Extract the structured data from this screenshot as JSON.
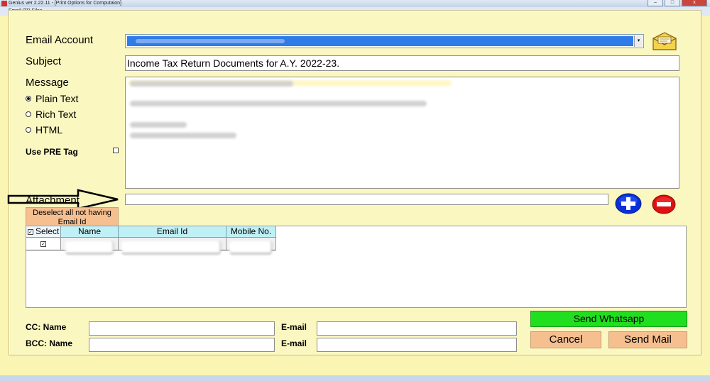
{
  "window": {
    "title": "Genius ver 2.22.11 - [Print Options for Computaion]",
    "controls": {
      "minimize": "–",
      "maximize": "□",
      "close": "x"
    }
  },
  "dialog": {
    "title": "Email ITR Files"
  },
  "form": {
    "email_account_label": "Email Account",
    "subject_label": "Subject",
    "subject_value": "Income Tax Return Documents for A.Y. 2022-23.",
    "message_label": "Message",
    "format_options": [
      {
        "label": "Plain Text",
        "selected": true
      },
      {
        "label": "Rich Text",
        "selected": false
      },
      {
        "label": "HTML",
        "selected": false
      }
    ],
    "use_pre_tag_label": "Use PRE Tag",
    "attachment_label": "Attachment"
  },
  "grid": {
    "deselect_label": "Deselect all not having Email Id",
    "columns": [
      "Select",
      "Name",
      "Email Id",
      "Mobile No."
    ],
    "rows": [
      {
        "selected": true
      }
    ]
  },
  "footer": {
    "cc_name_label": "CC: Name",
    "bcc_name_label": "BCC: Name",
    "email_label": "E-mail",
    "send_whatsapp": "Send Whatsapp",
    "cancel": "Cancel",
    "send_mail": "Send Mail"
  },
  "icons": {
    "envelope": "envelope-icon",
    "add": "plus-circle-icon",
    "remove": "minus-circle-icon",
    "arrow": "right-arrow-annotation"
  },
  "colors": {
    "panel_bg": "#fbf7c0",
    "selection_blue": "#2f7be8",
    "whatsapp_green": "#1fdf1f",
    "peach_button": "#f6bf90",
    "grid_header": "#bff0f6",
    "add_blue": "#0a2fd8",
    "remove_red": "#e01010"
  }
}
